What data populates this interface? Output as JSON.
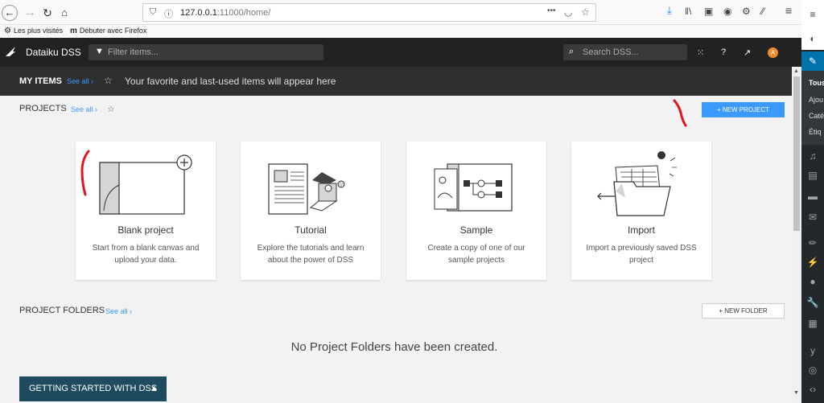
{
  "browser": {
    "url_host": "127.0.0.1",
    "url_rest": ":11000/home/",
    "more_label": "•••",
    "bookmarks": [
      {
        "icon": "gear-icon",
        "label": "Les plus visités"
      },
      {
        "icon": "firefox-icon",
        "label": "Débuter avec Firefox"
      }
    ]
  },
  "app": {
    "brand": "Dataiku DSS",
    "filter_placeholder": "Filter items...",
    "search_placeholder": "Search DSS...",
    "avatar_letter": "A"
  },
  "my_items": {
    "title": "MY ITEMS",
    "see_all": "See all ›",
    "message": "Your favorite and last-used items will appear here"
  },
  "projects": {
    "title": "PROJECTS",
    "see_all": "See all ›",
    "new_button": "+ NEW PROJECT",
    "cards": [
      {
        "title": "Blank project",
        "desc": "Start from a blank canvas and upload your data."
      },
      {
        "title": "Tutorial",
        "desc": "Explore the tutorials and learn about the power of DSS"
      },
      {
        "title": "Sample",
        "desc": "Create a copy of one of our sample projects"
      },
      {
        "title": "Import",
        "desc": "Import a previously saved DSS project"
      }
    ]
  },
  "folders": {
    "title": "PROJECT FOLDERS",
    "see_all": "See all ›",
    "new_button": "+ NEW FOLDER",
    "empty_message": "No Project Folders have been created."
  },
  "getting_started": {
    "label": "GETTING STARTED WITH DSS",
    "chevron": "⌃"
  },
  "wp_panel": {
    "submenu": [
      "Tous",
      "Ajou",
      "Caté",
      "Étiq"
    ]
  },
  "colors": {
    "accent": "#3b99fc",
    "appbar": "#222222",
    "myitems_bar": "#2f2f2f",
    "getting_started": "#1f4b5e",
    "annotation": "#e0141e",
    "avatar": "#f28a2c",
    "wp_active": "#0073aa"
  }
}
